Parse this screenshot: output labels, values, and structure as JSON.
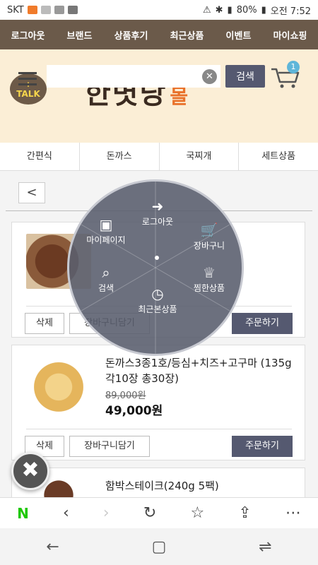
{
  "statusbar": {
    "carrier": "SKT",
    "battery": "80%",
    "time": "오전 7:52"
  },
  "topmenu": {
    "items": [
      "로그아웃",
      "브랜드",
      "상품후기",
      "최근상품",
      "이벤트",
      "마이쇼핑"
    ]
  },
  "header": {
    "talk_label": "TALK",
    "logo_text": "한볏당",
    "logo_suffix": "몰",
    "search_placeholder": "",
    "search_button": "검색",
    "cart_count": "1"
  },
  "categories": [
    "간편식",
    "돈까스",
    "국찌개",
    "세트상품"
  ],
  "back_label": "<",
  "radial_menu": {
    "items": [
      {
        "label": "로그아웃",
        "icon": "logout-icon",
        "glyph": "👤"
      },
      {
        "label": "장바구니",
        "icon": "cart-icon",
        "glyph": "🛒"
      },
      {
        "label": "찜한상품",
        "icon": "crown-icon",
        "glyph": "♕"
      },
      {
        "label": "최근본상품",
        "icon": "clock-icon",
        "glyph": "◷"
      },
      {
        "label": "검색",
        "icon": "search-icon",
        "glyph": "⌕"
      },
      {
        "label": "마이페이지",
        "icon": "bag-icon",
        "glyph": "▣"
      }
    ]
  },
  "products": [
    {
      "title": "",
      "orig_price": "",
      "price": "",
      "delete": "삭제",
      "add_cart": "장바구니담기",
      "order": "주문하기"
    },
    {
      "title": "돈까스3종1호/등심+치즈+고구마 (135g 각10장 총30장)",
      "orig_price": "89,000원",
      "price": "49,000원",
      "delete": "삭제",
      "add_cart": "장바구니담기",
      "order": "주문하기"
    },
    {
      "title": "함박스테이크(240g 5팩)",
      "orig_price": "",
      "price": "",
      "delete": "",
      "add_cart": "",
      "order": ""
    }
  ],
  "fab_close_glyph": "✖",
  "browserbar": {
    "naver": "N",
    "back": "‹",
    "forward": "›",
    "reload": "↻",
    "star": "☆",
    "share": "⇪",
    "more": "⋯"
  },
  "navbar": {
    "back": "←",
    "home": "▢",
    "recent": "⇌"
  }
}
